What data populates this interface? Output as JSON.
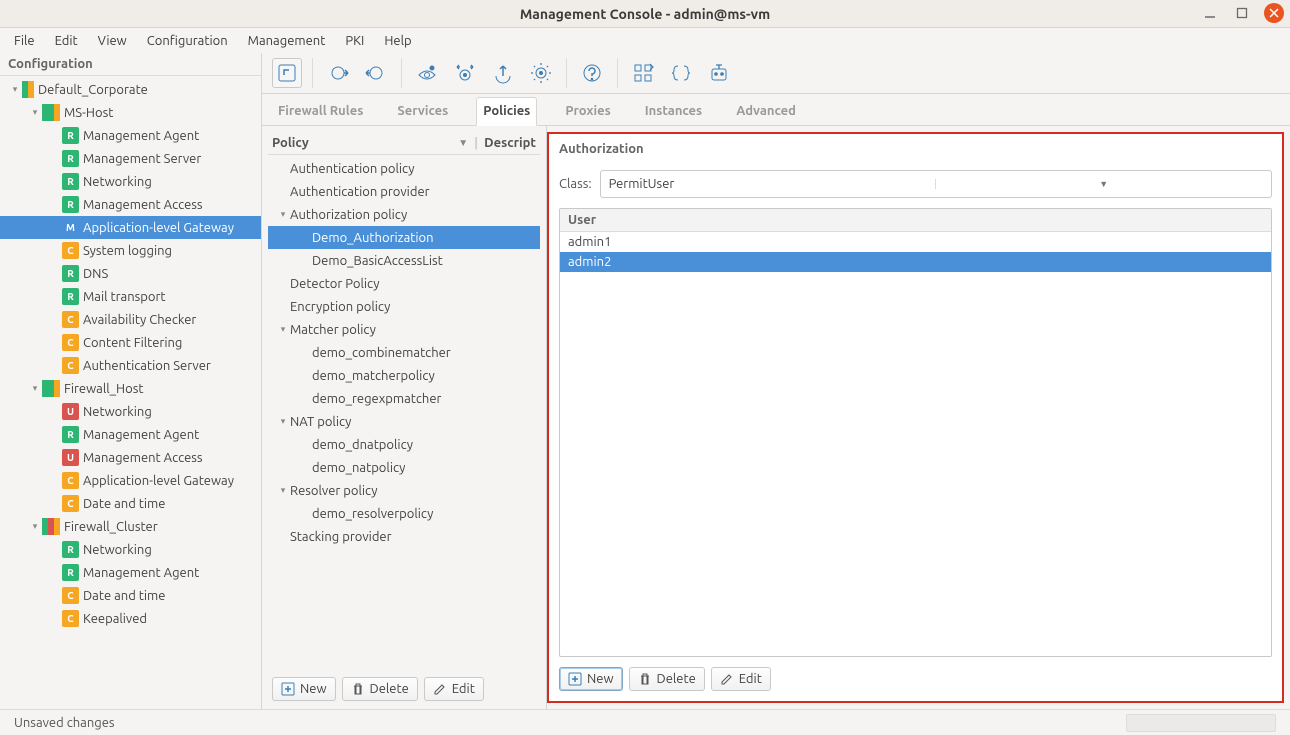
{
  "window": {
    "title": "Management Console - admin@ms-vm"
  },
  "menu": [
    "File",
    "Edit",
    "View",
    "Configuration",
    "Management",
    "PKI",
    "Help"
  ],
  "sidebar": {
    "header": "Configuration",
    "tree": [
      {
        "depth": 0,
        "expander": "▾",
        "multibox": [
          "g",
          "o"
        ],
        "label": "Default_Corporate"
      },
      {
        "depth": 1,
        "expander": "▾",
        "multibox": [
          "g",
          "g",
          "o"
        ],
        "label": "MS-Host"
      },
      {
        "depth": 2,
        "box": "R",
        "label": "Management Agent"
      },
      {
        "depth": 2,
        "box": "R",
        "label": "Management Server"
      },
      {
        "depth": 2,
        "box": "R",
        "label": "Networking"
      },
      {
        "depth": 2,
        "box": "R",
        "label": "Management Access"
      },
      {
        "depth": 2,
        "box": "M",
        "label": "Application-level Gateway",
        "selected": true
      },
      {
        "depth": 2,
        "box": "C",
        "label": "System logging"
      },
      {
        "depth": 2,
        "box": "R",
        "label": "DNS"
      },
      {
        "depth": 2,
        "box": "R",
        "label": "Mail transport"
      },
      {
        "depth": 2,
        "box": "C",
        "label": "Availability Checker"
      },
      {
        "depth": 2,
        "box": "C",
        "label": "Content Filtering"
      },
      {
        "depth": 2,
        "box": "C",
        "label": "Authentication Server"
      },
      {
        "depth": 1,
        "expander": "▾",
        "multibox": [
          "g",
          "g",
          "o"
        ],
        "label": "Firewall_Host"
      },
      {
        "depth": 2,
        "box": "U",
        "label": "Networking"
      },
      {
        "depth": 2,
        "box": "R",
        "label": "Management Agent"
      },
      {
        "depth": 2,
        "box": "U",
        "label": "Management Access"
      },
      {
        "depth": 2,
        "box": "C",
        "label": "Application-level Gateway"
      },
      {
        "depth": 2,
        "box": "C",
        "label": "Date and time"
      },
      {
        "depth": 1,
        "expander": "▾",
        "multibox": [
          "g",
          "r",
          "o"
        ],
        "label": "Firewall_Cluster"
      },
      {
        "depth": 2,
        "box": "R",
        "label": "Networking"
      },
      {
        "depth": 2,
        "box": "R",
        "label": "Management Agent"
      },
      {
        "depth": 2,
        "box": "C",
        "label": "Date and time"
      },
      {
        "depth": 2,
        "box": "C",
        "label": "Keepalived"
      }
    ]
  },
  "tabs": [
    "Firewall Rules",
    "Services",
    "Policies",
    "Proxies",
    "Instances",
    "Advanced"
  ],
  "tabs_active": 2,
  "policy": {
    "col1": "Policy",
    "col1_arrow": "▼",
    "sep": "|",
    "col2": "Descript",
    "tree": [
      {
        "depth": 0,
        "label": "Authentication policy"
      },
      {
        "depth": 0,
        "label": "Authentication provider"
      },
      {
        "depth": 0,
        "expander": "▾",
        "label": "Authorization policy"
      },
      {
        "depth": 1,
        "label": "Demo_Authorization",
        "selected": true
      },
      {
        "depth": 1,
        "label": "Demo_BasicAccessList"
      },
      {
        "depth": 0,
        "label": "Detector Policy"
      },
      {
        "depth": 0,
        "label": "Encryption policy"
      },
      {
        "depth": 0,
        "expander": "▾",
        "label": "Matcher policy"
      },
      {
        "depth": 1,
        "label": "demo_combinematcher"
      },
      {
        "depth": 1,
        "label": "demo_matcherpolicy"
      },
      {
        "depth": 1,
        "label": "demo_regexpmatcher"
      },
      {
        "depth": 0,
        "expander": "▾",
        "label": "NAT policy"
      },
      {
        "depth": 1,
        "label": "demo_dnatpolicy"
      },
      {
        "depth": 1,
        "label": "demo_natpolicy"
      },
      {
        "depth": 0,
        "expander": "▾",
        "label": "Resolver policy"
      },
      {
        "depth": 1,
        "label": "demo_resolverpolicy"
      },
      {
        "depth": 0,
        "label": "Stacking provider"
      }
    ],
    "btn_new": "New",
    "btn_delete": "Delete",
    "btn_edit": "Edit"
  },
  "detail": {
    "title": "Authorization",
    "class_label": "Class:",
    "class_value": "PermitUser",
    "user_col": "User",
    "users": [
      {
        "name": "admin1"
      },
      {
        "name": "admin2",
        "selected": true
      }
    ],
    "btn_new": "New",
    "btn_delete": "Delete",
    "btn_edit": "Edit"
  },
  "status": "Unsaved changes"
}
